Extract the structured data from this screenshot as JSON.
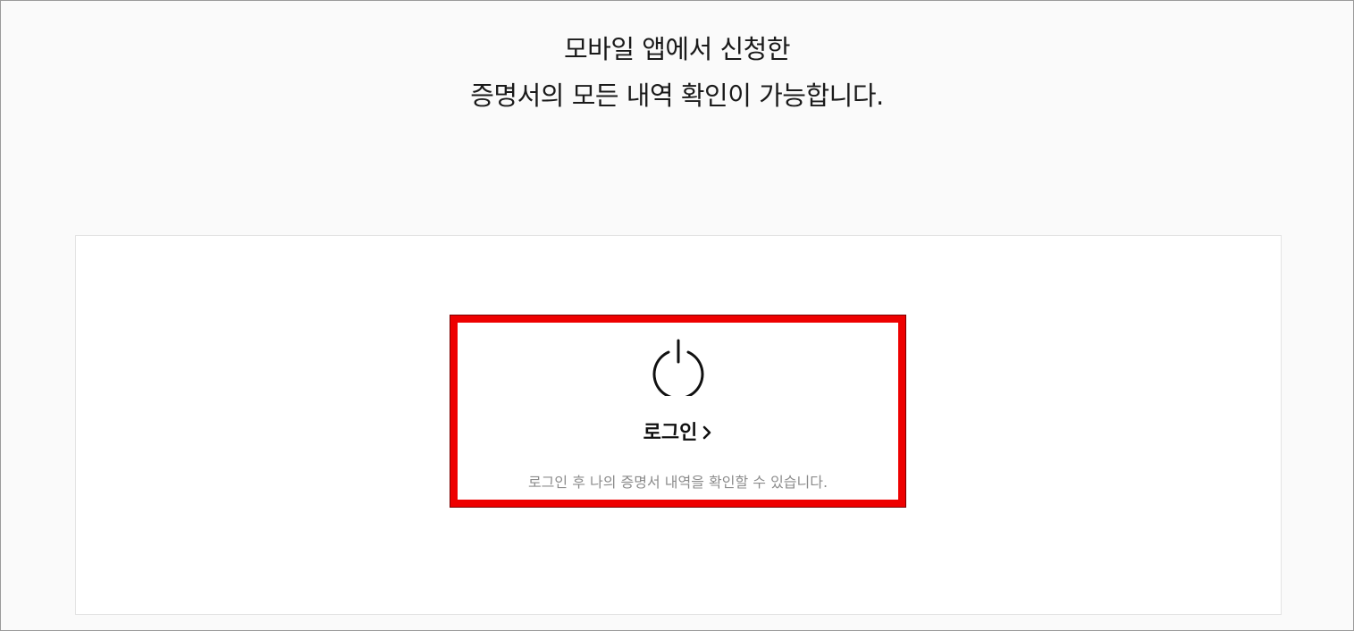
{
  "headline": {
    "line1": "모바일 앱에서 신청한",
    "line2": "증명서의 모든 내역 확인이 가능합니다."
  },
  "login": {
    "label": "로그인",
    "description": "로그인 후 나의 증명서 내역을 확인할 수 있습니다.",
    "icon": "power-icon",
    "arrow_icon": "chevron-right-icon"
  },
  "colors": {
    "highlight_border": "#ee0000",
    "page_background": "#fafafa",
    "panel_background": "#ffffff",
    "text_primary": "#111111",
    "text_secondary": "#8c8c8c"
  }
}
